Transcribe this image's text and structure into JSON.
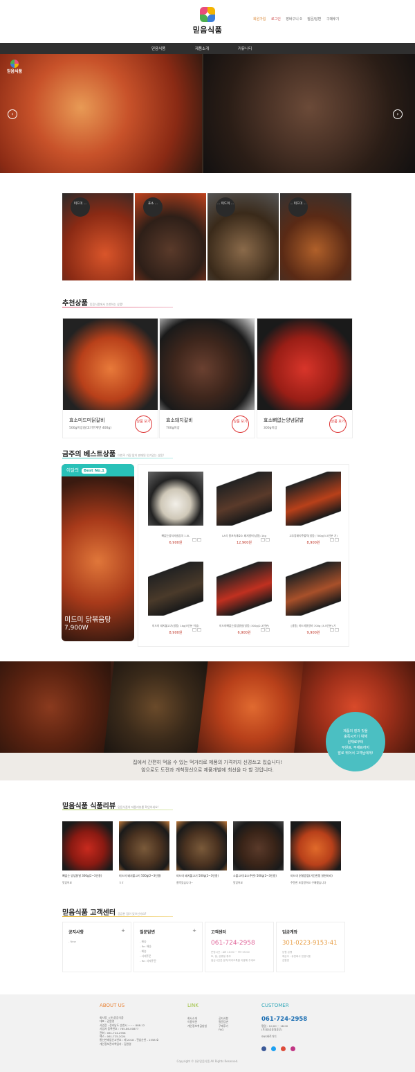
{
  "header": {
    "logo_text": "믿음식품",
    "top_links": [
      {
        "label": "회원가입"
      },
      {
        "label": "로그인"
      },
      {
        "label": "장바구니 0"
      },
      {
        "label": "질문/답변"
      },
      {
        "label": "구매후기"
      }
    ]
  },
  "gnb": {
    "items": [
      "믿음식품",
      "제품소개",
      "커뮤니티"
    ]
  },
  "hero": {
    "logo_text": "믿음식품",
    "prev": "‹",
    "next": "›"
  },
  "promos": [
    {
      "badge": "미드미 ..."
    },
    {
      "badge": "효소 ..."
    },
    {
      "badge": "... 미드미 ..."
    },
    {
      "badge": "... 미드미 ..."
    }
  ],
  "recommended": {
    "title": "추천상품",
    "subtitle": "믿음식품에서 추천하는 상품!",
    "items": [
      {
        "name": "효소미드미닭갈비",
        "sub": "500g이상(닭고기무게만 400g)",
        "button": "상품 보기"
      },
      {
        "name": "효소돼지갈비",
        "sub": "700g이상",
        "button": "상품 보기"
      },
      {
        "name": "효소뼈없는양념닭발",
        "sub": "300g이상",
        "button": "상품 보기"
      }
    ]
  },
  "best": {
    "title": "금주의 베스트상품",
    "subtitle": "이번주 가장 많이 판매된 인기있는 상품!",
    "monthly_label": "이달의",
    "monthly_badge": "Best No.1",
    "monthly_name": "미드미 닭볶음탕",
    "monthly_price": "7,900W",
    "items": [
      {
        "name": "뼈없는양지사골곰국 1.5L",
        "price": "6,900원"
      },
      {
        "name": "LA식 왕포속대효소 돼지갈비(냉동) 1kg",
        "price": "12,900원"
      },
      {
        "name": "고추장돼지주물럭(냉동) 700g(3-5인분 기)",
        "price": "8,900원"
      },
      {
        "name": "미드미 돼지불고기(냉동) 1kg(5인분 이상)",
        "price": "8,900원"
      },
      {
        "name": "미드미뼈없는양념닭발(냉동) 300g(2-3인분)",
        "price": "6,900원"
      },
      {
        "name": "[냉동] 미드미닭갈비 700g (3-5인분) 기",
        "price": "9,900원"
      }
    ]
  },
  "banner": {
    "line1": "집에서 간편히 먹을 수 있는 먹거리로 제품의 가격까지 신경쓰고 있습니다!",
    "line2": "앞으로도 도전과 개척정신으로 제품개발에 최선을 다 할 것입니다.",
    "circle": [
      "제품의 질과 맛을",
      "충족시키기 위해",
      "원재료부터",
      "부원료, 부재료까지",
      "발로 뛰어서 고객님에게!"
    ]
  },
  "reviews": {
    "title": "믿음식품 식품리뷰",
    "subtitle": "믿음식품의 제품리뷰를 확인하세요!",
    "items": [
      {
        "name": "뼈없는 양념닭발 300g(2~3인용)",
        "sub": "맛있어요"
      },
      {
        "name": "미드미 돼지불고기 500g(2~3인용)",
        "sub": "ㅎㅎ"
      },
      {
        "name": "미드미 돼지불고기 500g(2~3인용)",
        "sub": "잘먹었습니다~"
      },
      {
        "name": "소불고기(효소주관) 500g(2~3인용)",
        "sub": "맛있어요"
      },
      {
        "name": "미드미 닭볶음탕(기간한정 닭한마리)",
        "sub": "주문한 포장왔어요 구매했습니다"
      }
    ]
  },
  "customer": {
    "title": "믿음식품 고객센터",
    "subtitle": "궁금한 점이 있으신가요?",
    "notice": {
      "title": "공지사항",
      "plus": "+",
      "items": [
        "- New"
      ]
    },
    "qna": {
      "title": "질문답변",
      "plus": "+",
      "items": [
        "- 배송",
        "- Re: 배송",
        "- 배송",
        "- 사재주문",
        "- Re: 사재주문"
      ]
    },
    "center": {
      "title": "고객센터",
      "phone": "061-724-2958",
      "info": [
        "운영시간 : AM 10:00 ~ PM 05:00",
        "토, 일, 공휴일 휴무",
        "점심시간은 문자/카카오톡을 이용해 주세요"
      ]
    },
    "account": {
      "title": "입금계좌",
      "number": "301-0223-9153-41",
      "info": [
        "농협 은행",
        "예금주 : 유한회사 믿음식품",
        "김원영"
      ]
    }
  },
  "footer": {
    "about_title": "ABOUT US",
    "about_lines": [
      "회사명 : (유)믿음식품",
      "대표 : 김원영",
      "사업장 : 전라남도 순천시 ~~~ 888-12",
      "사업자 등록번호 : 765-86-00877",
      "전화 : 061-724-2958",
      "팩스 : 061-725-2024",
      "통신판매업신고번호 : 제 2018 - 전남순천 - 1558 호",
      "개인정보관리책임자 : 김원영"
    ],
    "link_title": "LINK",
    "links_col1": [
      "회사소개",
      "이용약관",
      "개인정보취급방침"
    ],
    "links_col2": [
      "공지사항",
      "질문답변",
      "구매후기"
    ],
    "links_col3": [
      "FAQ"
    ],
    "customer_title": "CUSTOMER",
    "customer_phone": "061-724-2958",
    "customer_hours": [
      "평일 : 10:00 ~ 18:00",
      "(토/일/공휴일휴무)"
    ],
    "sns_label": "SNS바로가기",
    "copyright": "Copyright © (유)믿음식품 All Rights Reserved."
  },
  "colors": {
    "accent_teal": "#29c1b8",
    "accent_red": "#d33",
    "price_red": "#c0392b",
    "phone_pink": "#e0669a",
    "account_orange": "#e8a04a",
    "footer_blue": "#1d6fb3",
    "link_green": "#9bbf3b",
    "about_orange": "#e8853a"
  }
}
